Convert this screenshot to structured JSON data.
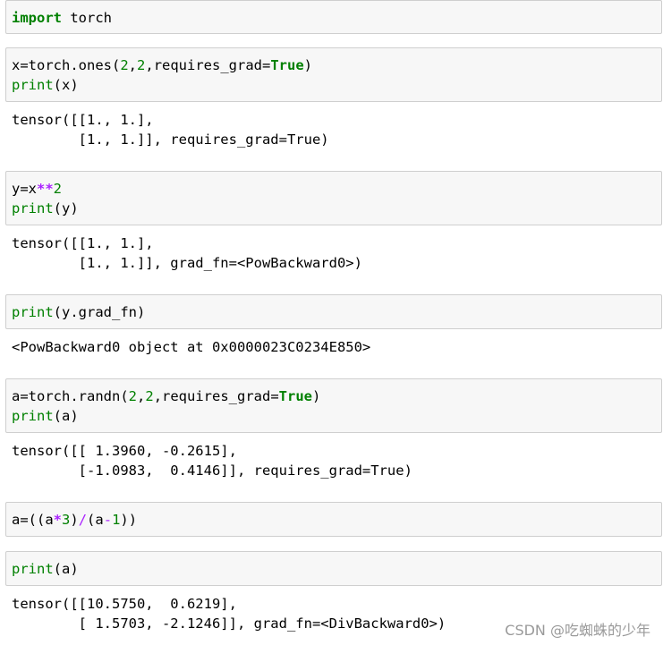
{
  "cells": [
    {
      "input_lines": [
        [
          {
            "t": "import",
            "c": "kw"
          },
          {
            "t": " torch",
            "c": "tok"
          }
        ]
      ]
    },
    {
      "input_lines": [
        [
          {
            "t": "x=torch.ones(",
            "c": "tok"
          },
          {
            "t": "2",
            "c": "num"
          },
          {
            "t": ",",
            "c": "tok"
          },
          {
            "t": "2",
            "c": "num"
          },
          {
            "t": ",requires_grad=",
            "c": "tok"
          },
          {
            "t": "True",
            "c": "kw"
          },
          {
            "t": ")",
            "c": "tok"
          }
        ],
        [
          {
            "t": "print",
            "c": "bi"
          },
          {
            "t": "(x)",
            "c": "tok"
          }
        ]
      ],
      "output_lines": [
        "tensor([[1., 1.],",
        "        [1., 1.]], requires_grad=True)"
      ]
    },
    {
      "input_lines": [
        [
          {
            "t": "y=x",
            "c": "tok"
          },
          {
            "t": "**",
            "c": "op"
          },
          {
            "t": "2",
            "c": "num"
          }
        ],
        [
          {
            "t": "print",
            "c": "bi"
          },
          {
            "t": "(y)",
            "c": "tok"
          }
        ]
      ],
      "output_lines": [
        "tensor([[1., 1.],",
        "        [1., 1.]], grad_fn=<PowBackward0>)"
      ]
    },
    {
      "input_lines": [
        [
          {
            "t": "print",
            "c": "bi"
          },
          {
            "t": "(y.grad_fn)",
            "c": "tok"
          }
        ]
      ],
      "output_lines": [
        "<PowBackward0 object at 0x0000023C0234E850>"
      ]
    },
    {
      "input_lines": [
        [
          {
            "t": "a=torch.randn(",
            "c": "tok"
          },
          {
            "t": "2",
            "c": "num"
          },
          {
            "t": ",",
            "c": "tok"
          },
          {
            "t": "2",
            "c": "num"
          },
          {
            "t": ",requires_grad=",
            "c": "tok"
          },
          {
            "t": "True",
            "c": "kw"
          },
          {
            "t": ")",
            "c": "tok"
          }
        ],
        [
          {
            "t": "print",
            "c": "bi"
          },
          {
            "t": "(a)",
            "c": "tok"
          }
        ]
      ],
      "output_lines": [
        "tensor([[ 1.3960, -0.2615],",
        "        [-1.0983,  0.4146]], requires_grad=True)"
      ]
    },
    {
      "input_lines": [
        [
          {
            "t": "a=((a",
            "c": "tok"
          },
          {
            "t": "*",
            "c": "op"
          },
          {
            "t": "3",
            "c": "num"
          },
          {
            "t": ")",
            "c": "tok"
          },
          {
            "t": "/",
            "c": "opn"
          },
          {
            "t": "(a",
            "c": "tok"
          },
          {
            "t": "-",
            "c": "opn"
          },
          {
            "t": "1",
            "c": "num"
          },
          {
            "t": "))",
            "c": "tok"
          }
        ]
      ]
    },
    {
      "input_lines": [
        [
          {
            "t": "print",
            "c": "bi"
          },
          {
            "t": "(a)",
            "c": "tok"
          }
        ]
      ],
      "output_lines": [
        "tensor([[10.5750,  0.6219],",
        "        [ 1.5703, -2.1246]], grad_fn=<DivBackward0>)"
      ]
    }
  ],
  "watermark": "CSDN @吃蜘蛛的少年"
}
